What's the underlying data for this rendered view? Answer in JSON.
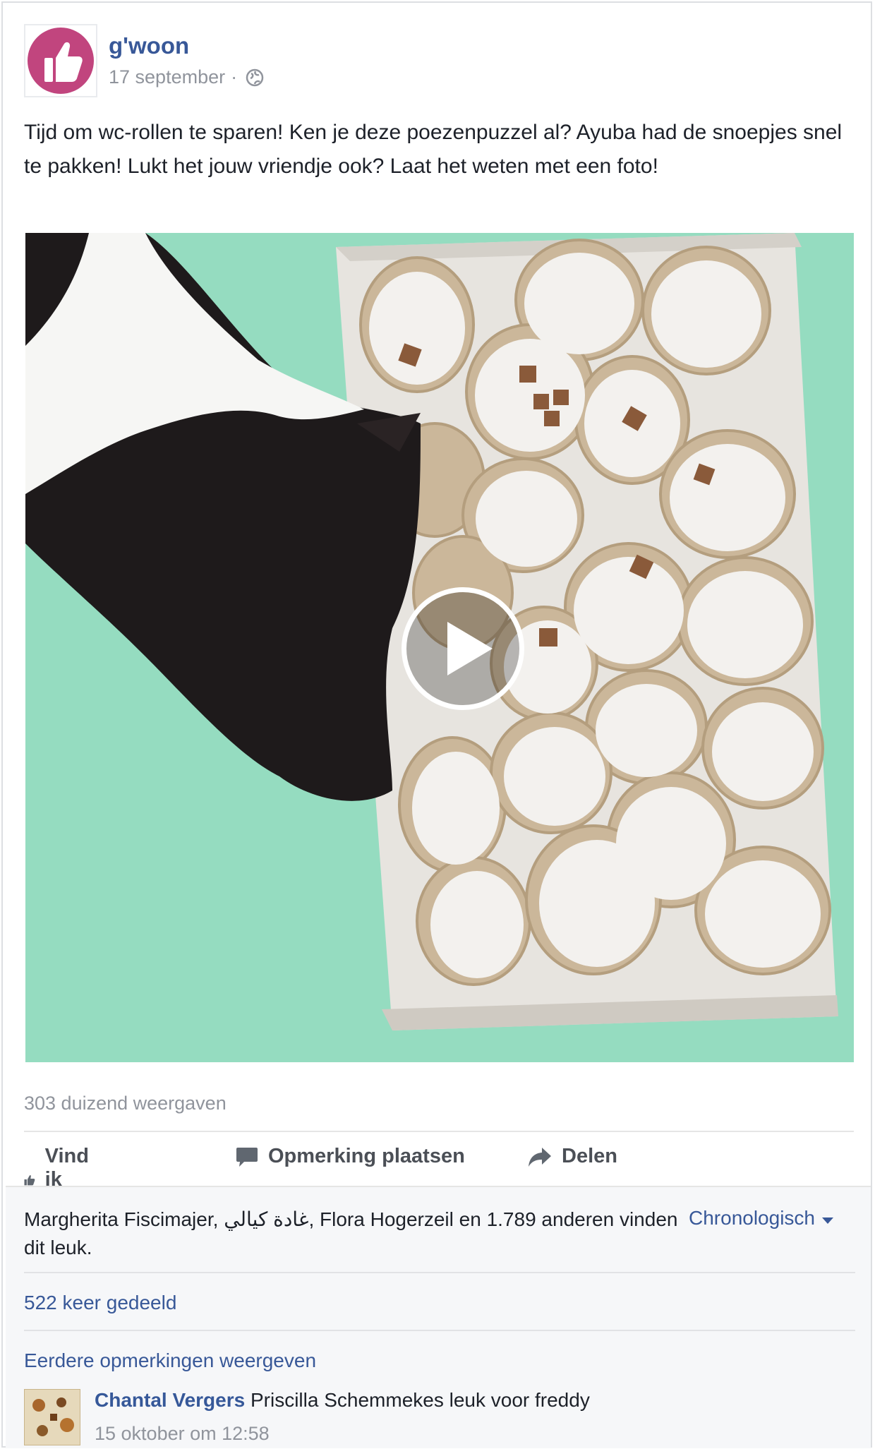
{
  "post": {
    "page_name": "g'woon",
    "date": "17 september",
    "separator": "·",
    "privacy_icon": "globe-icon",
    "text": "Tijd om wc-rollen te sparen! Ken je deze poezenpuzzel al? Ayuba had de snoepjes snel te pakken! Lukt het jouw vriendje ook? Laat het weten met een foto!",
    "avatar_icon": "thumbs-up-icon",
    "avatar_color": "#c1457e"
  },
  "video": {
    "play_icon": "play-icon",
    "views": "303 duizend weergaven"
  },
  "actions": {
    "like": "Vind ik leuk",
    "comment": "Opmerking plaatsen",
    "share": "Delen"
  },
  "feedback": {
    "likers": "Margherita Fiscimajer, غادة كيالي, Flora Hogerzeil en 1.789 anderen vinden dit leuk.",
    "sort_label": "Chronologisch",
    "shares": "522 keer gedeeld",
    "more_comments": "Eerdere opmerkingen weergeven"
  },
  "comment": {
    "author": "Chantal Vergers",
    "text": "Priscilla Schemmekes leuk voor freddy",
    "time": "15 oktober om 12:58"
  },
  "colors": {
    "link": "#385898",
    "muted": "#90949c",
    "background_video": "#95dcc0"
  }
}
